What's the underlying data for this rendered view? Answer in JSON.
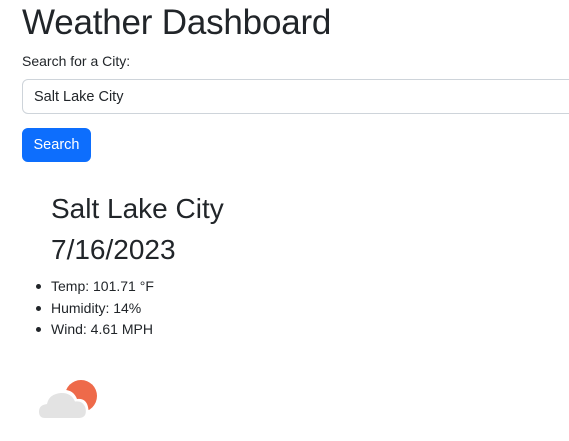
{
  "header": {
    "title": "Weather Dashboard"
  },
  "search": {
    "label": "Search for a City:",
    "value": "Salt Lake City",
    "button_label": "Search"
  },
  "forecast": {
    "city": "Salt Lake City",
    "date": "7/16/2023",
    "stats": [
      "Temp: 101.71 °F",
      "Humidity: 14%",
      "Wind: 4.61 MPH"
    ],
    "icon": "partly-cloudy-night-icon",
    "icon_colors": {
      "sun": "#ee6a4a",
      "cloud": "#e3e3e3"
    }
  },
  "colors": {
    "primary": "#0d6efd",
    "text": "#212529",
    "input_border": "#ced4da"
  }
}
